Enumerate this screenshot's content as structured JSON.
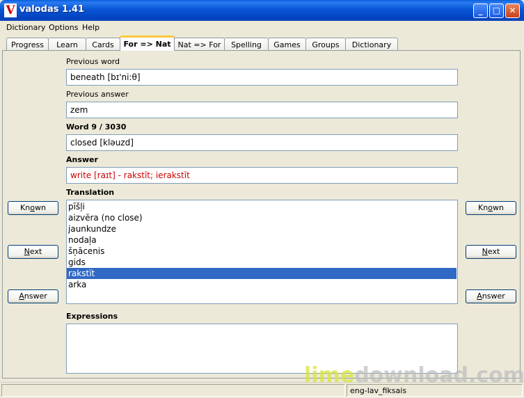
{
  "window": {
    "title": "valodas 1.41",
    "icon_letter": "V",
    "minimize": "_",
    "maximize": "□",
    "close": "✕"
  },
  "menu": [
    "Dictionary",
    "Options",
    "Help"
  ],
  "tabs": [
    "Progress",
    "Learn",
    "Cards",
    "For => Nat",
    "Nat => For",
    "Spelling",
    "Games",
    "Groups",
    "Dictionary"
  ],
  "active_tab": "For => Nat",
  "fields": {
    "previous_word_label": "Previous word",
    "previous_word_value": "beneath [bɪ'ni:θ]",
    "previous_answer_label": "Previous answer",
    "previous_answer_value": "zem",
    "word_label": "Word 9 / 3030",
    "word_value": "closed [kləuzd]",
    "answer_label": "Answer",
    "answer_value": "write [raɪt] - rakstīt; ierakstīt",
    "translation_label": "Translation",
    "expressions_label": "Expressions"
  },
  "translation_list": [
    "pīšļi",
    "aizvēra (no close)",
    "jaunkundze",
    "nodaļa",
    "šņācenis",
    "gids",
    "rakstīt",
    "arka"
  ],
  "selected_translation": "rakstīt",
  "buttons": {
    "known": {
      "pre": "Kn",
      "key": "o",
      "post": "wn"
    },
    "next": {
      "pre": "",
      "key": "N",
      "post": "ext"
    },
    "answer": {
      "pre": "",
      "key": "A",
      "post": "nswer"
    }
  },
  "status": {
    "dictionary": "eng-lav_fiksais"
  },
  "watermark": {
    "part1": "lime",
    "part2": "download.com"
  },
  "colors": {
    "answer_text": "#cc0000",
    "selection": "#316ac5",
    "active_tab_accent": "#ffc83c"
  }
}
